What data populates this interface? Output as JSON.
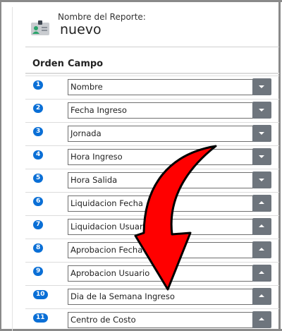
{
  "header": {
    "label": "Nombre del Reporte:",
    "report_name": "nuevo",
    "icon": "id-card-icon"
  },
  "table": {
    "columns": [
      "Orden",
      "Campo"
    ],
    "rows": [
      {
        "order": "1",
        "campo": "Nombre",
        "toggle": "down"
      },
      {
        "order": "2",
        "campo": "Fecha Ingreso",
        "toggle": "down"
      },
      {
        "order": "3",
        "campo": "Jornada",
        "toggle": "down"
      },
      {
        "order": "4",
        "campo": "Hora Ingreso",
        "toggle": "down"
      },
      {
        "order": "5",
        "campo": "Hora Salida",
        "toggle": "down"
      },
      {
        "order": "6",
        "campo": "Liquidacion Fecha",
        "toggle": "up"
      },
      {
        "order": "7",
        "campo": "Liquidacion Usuario",
        "toggle": "up"
      },
      {
        "order": "8",
        "campo": "Aprobacion Fecha",
        "toggle": "up"
      },
      {
        "order": "9",
        "campo": "Aprobacion Usuario",
        "toggle": "up"
      },
      {
        "order": "10",
        "campo": "Dia de la Semana Ingreso",
        "toggle": "up"
      },
      {
        "order": "11",
        "campo": "Centro de Costo",
        "toggle": "up"
      }
    ]
  },
  "overlay": {
    "icon": "red-curved-arrow-icon",
    "color": "#ff0000"
  }
}
